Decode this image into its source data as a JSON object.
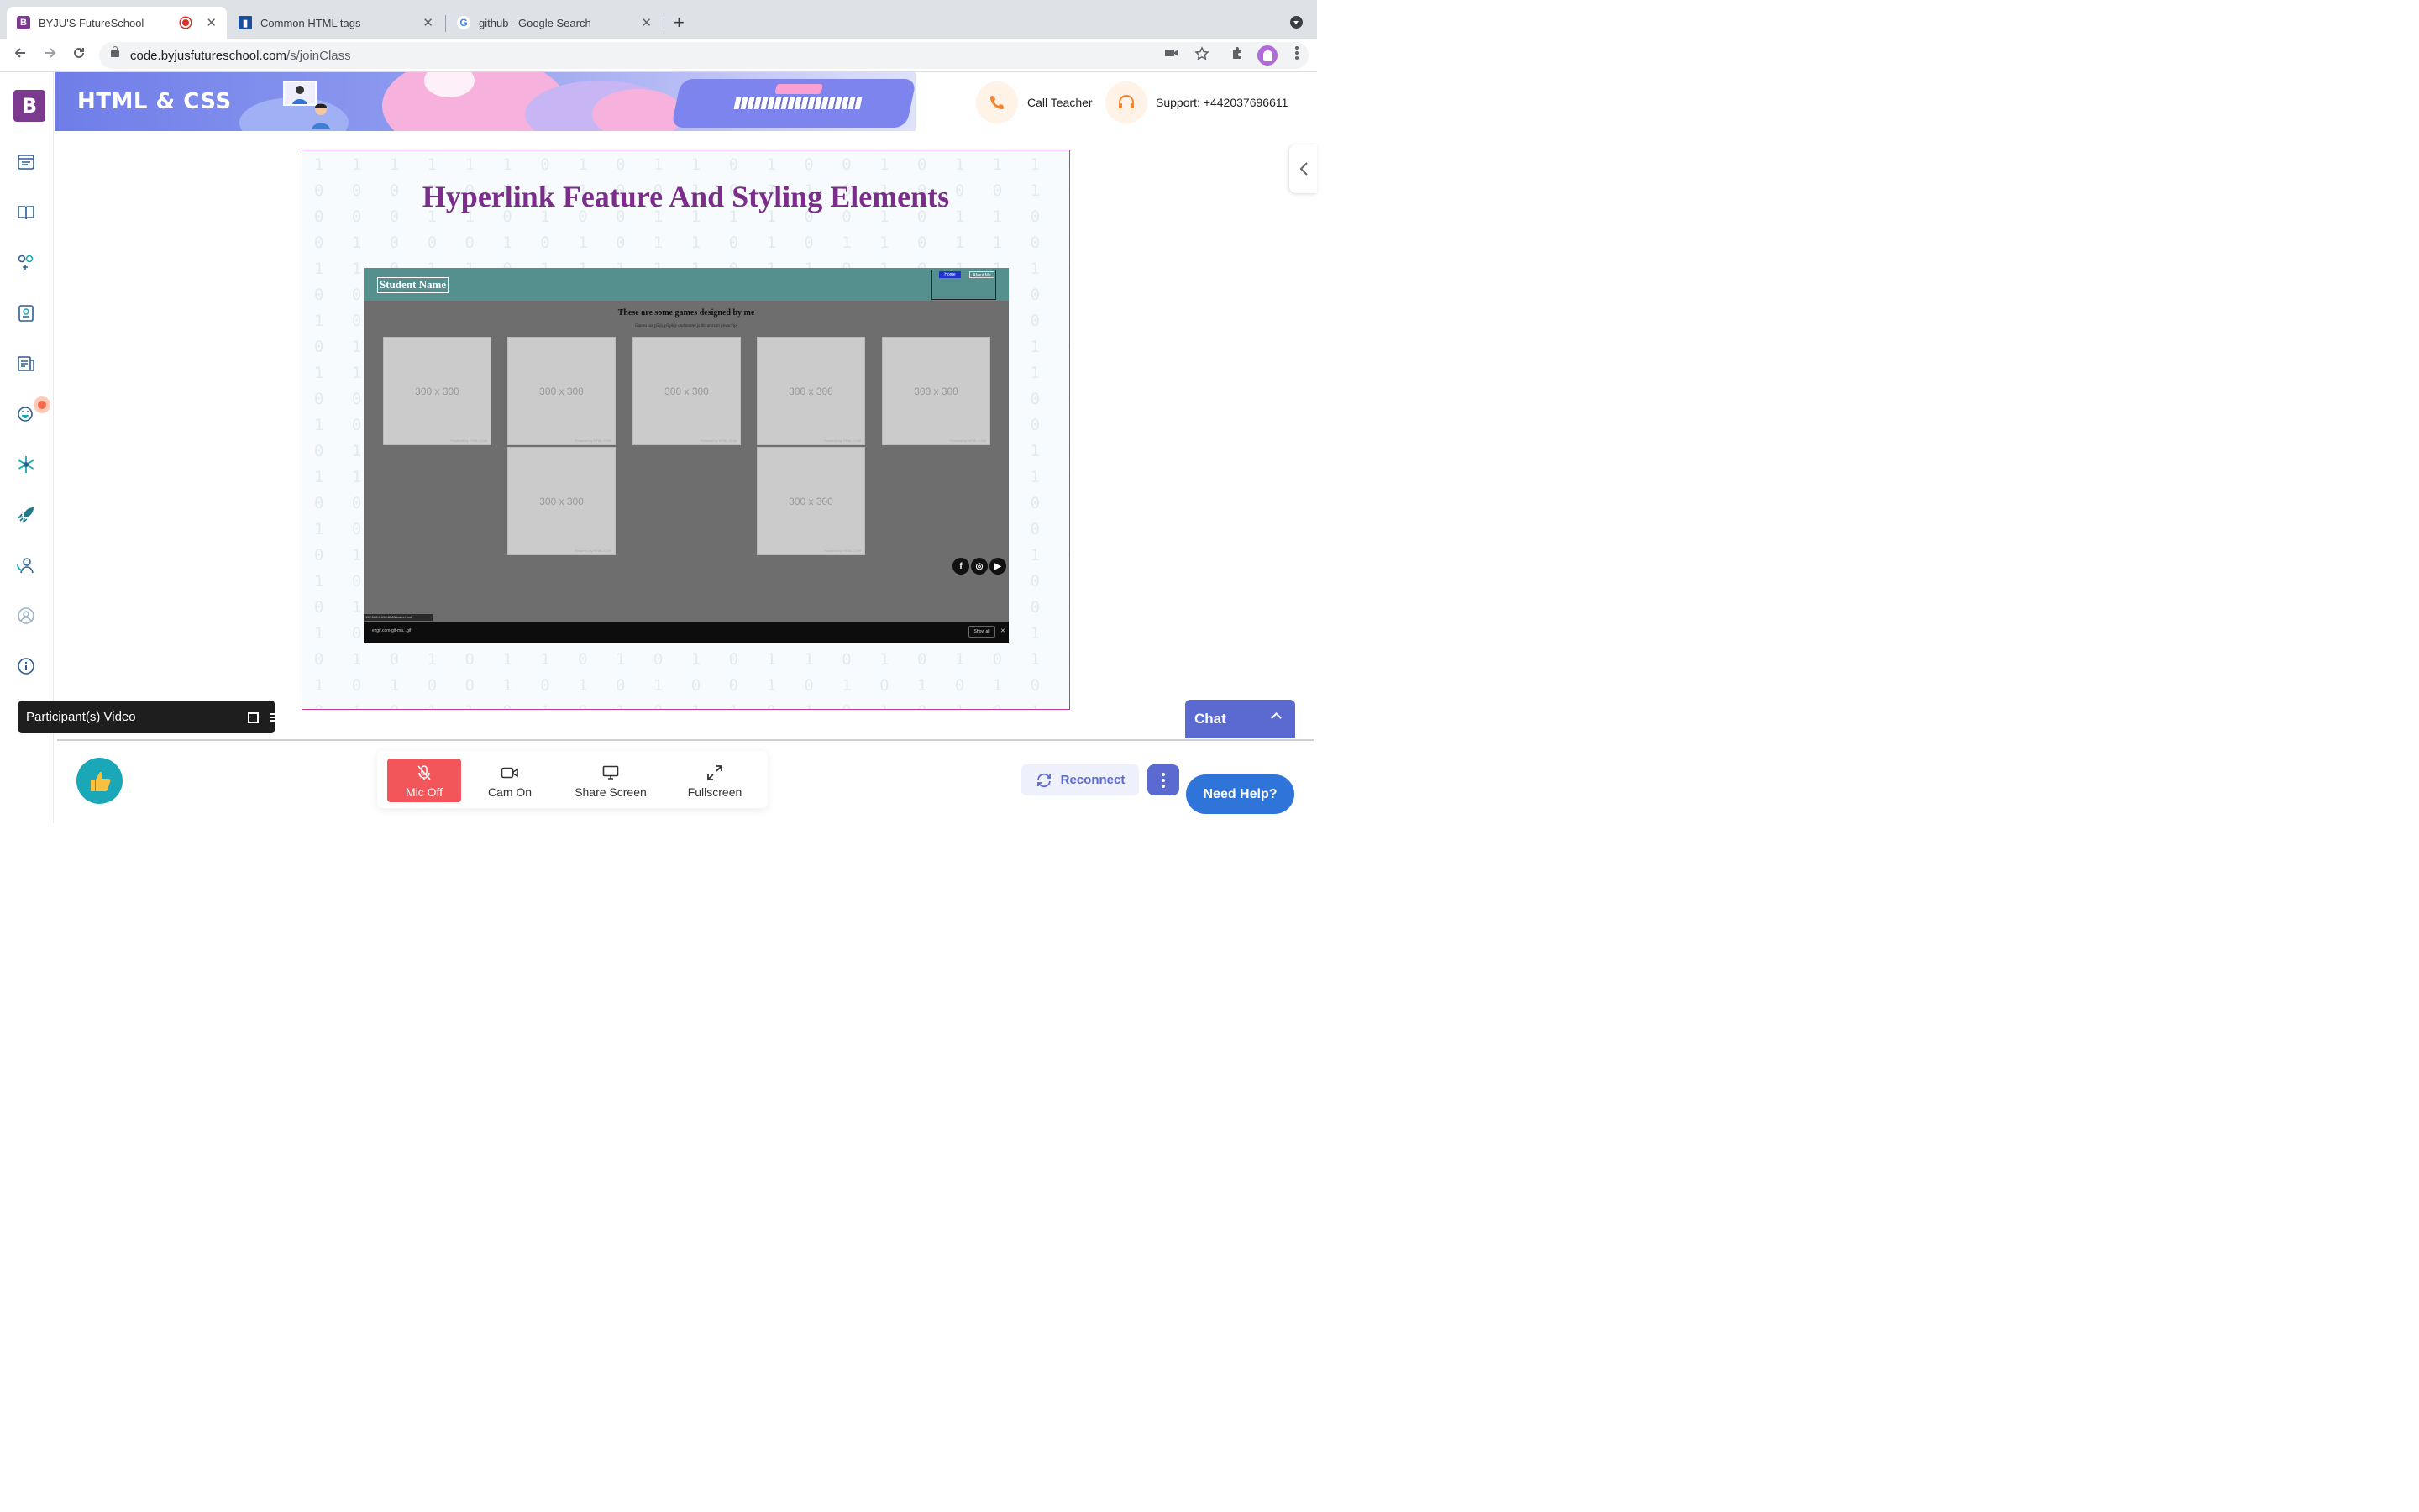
{
  "browser": {
    "tabs": [
      {
        "title": "BYJU'S FutureSchool",
        "favicon": "byjus-favicon",
        "recording": true
      },
      {
        "title": "Common HTML tags",
        "favicon": "document-favicon"
      },
      {
        "title": "github - Google Search",
        "favicon": "google-favicon"
      }
    ],
    "url_host": "code.byjusfutureschool.com",
    "url_path": "/s/joinClass",
    "new_tab_glyph": "+",
    "close_glyph": "✕"
  },
  "app": {
    "logo_letter": "B",
    "banner_title": "HTML & CSS",
    "call_teacher": "Call Teacher",
    "support": "Support: +442037696611",
    "sidebar_icons": [
      "dashboard-icon",
      "book-icon",
      "activity-icon",
      "notes-icon",
      "report-icon",
      "emoji-icon",
      "snowflake-icon",
      "rocket-icon",
      "support-icon",
      "profile-icon",
      "info-icon"
    ],
    "accent_color": "#5b6ad0",
    "brand_color": "#7b3a8e"
  },
  "slide": {
    "title": "Hyperlink Feature And Styling Elements",
    "screenshot": {
      "student_name": "Student Name",
      "nav_btn_1": "Home",
      "nav_btn_2": "About Me",
      "heading": "These are some games designed by me",
      "subheading": "Games use p5.js, p5.play and matter.js libraries in javascript",
      "placeholder_text": "300 x 300",
      "powered_by": "Powered by HTML.COM",
      "status_url": "192.168.0.198:8080/index.html",
      "download_file": "ezgif.com-gif-ma...gif",
      "show_all": "Show all",
      "close": "✕",
      "social": [
        "f",
        "◎",
        "▶"
      ]
    }
  },
  "participants": {
    "label": "Participant(s) Video"
  },
  "controls": {
    "mic": "Mic Off",
    "cam": "Cam On",
    "share": "Share Screen",
    "fullscreen": "Fullscreen"
  },
  "actions": {
    "reconnect": "Reconnect",
    "chat": "Chat",
    "need_help": "Need Help?"
  }
}
